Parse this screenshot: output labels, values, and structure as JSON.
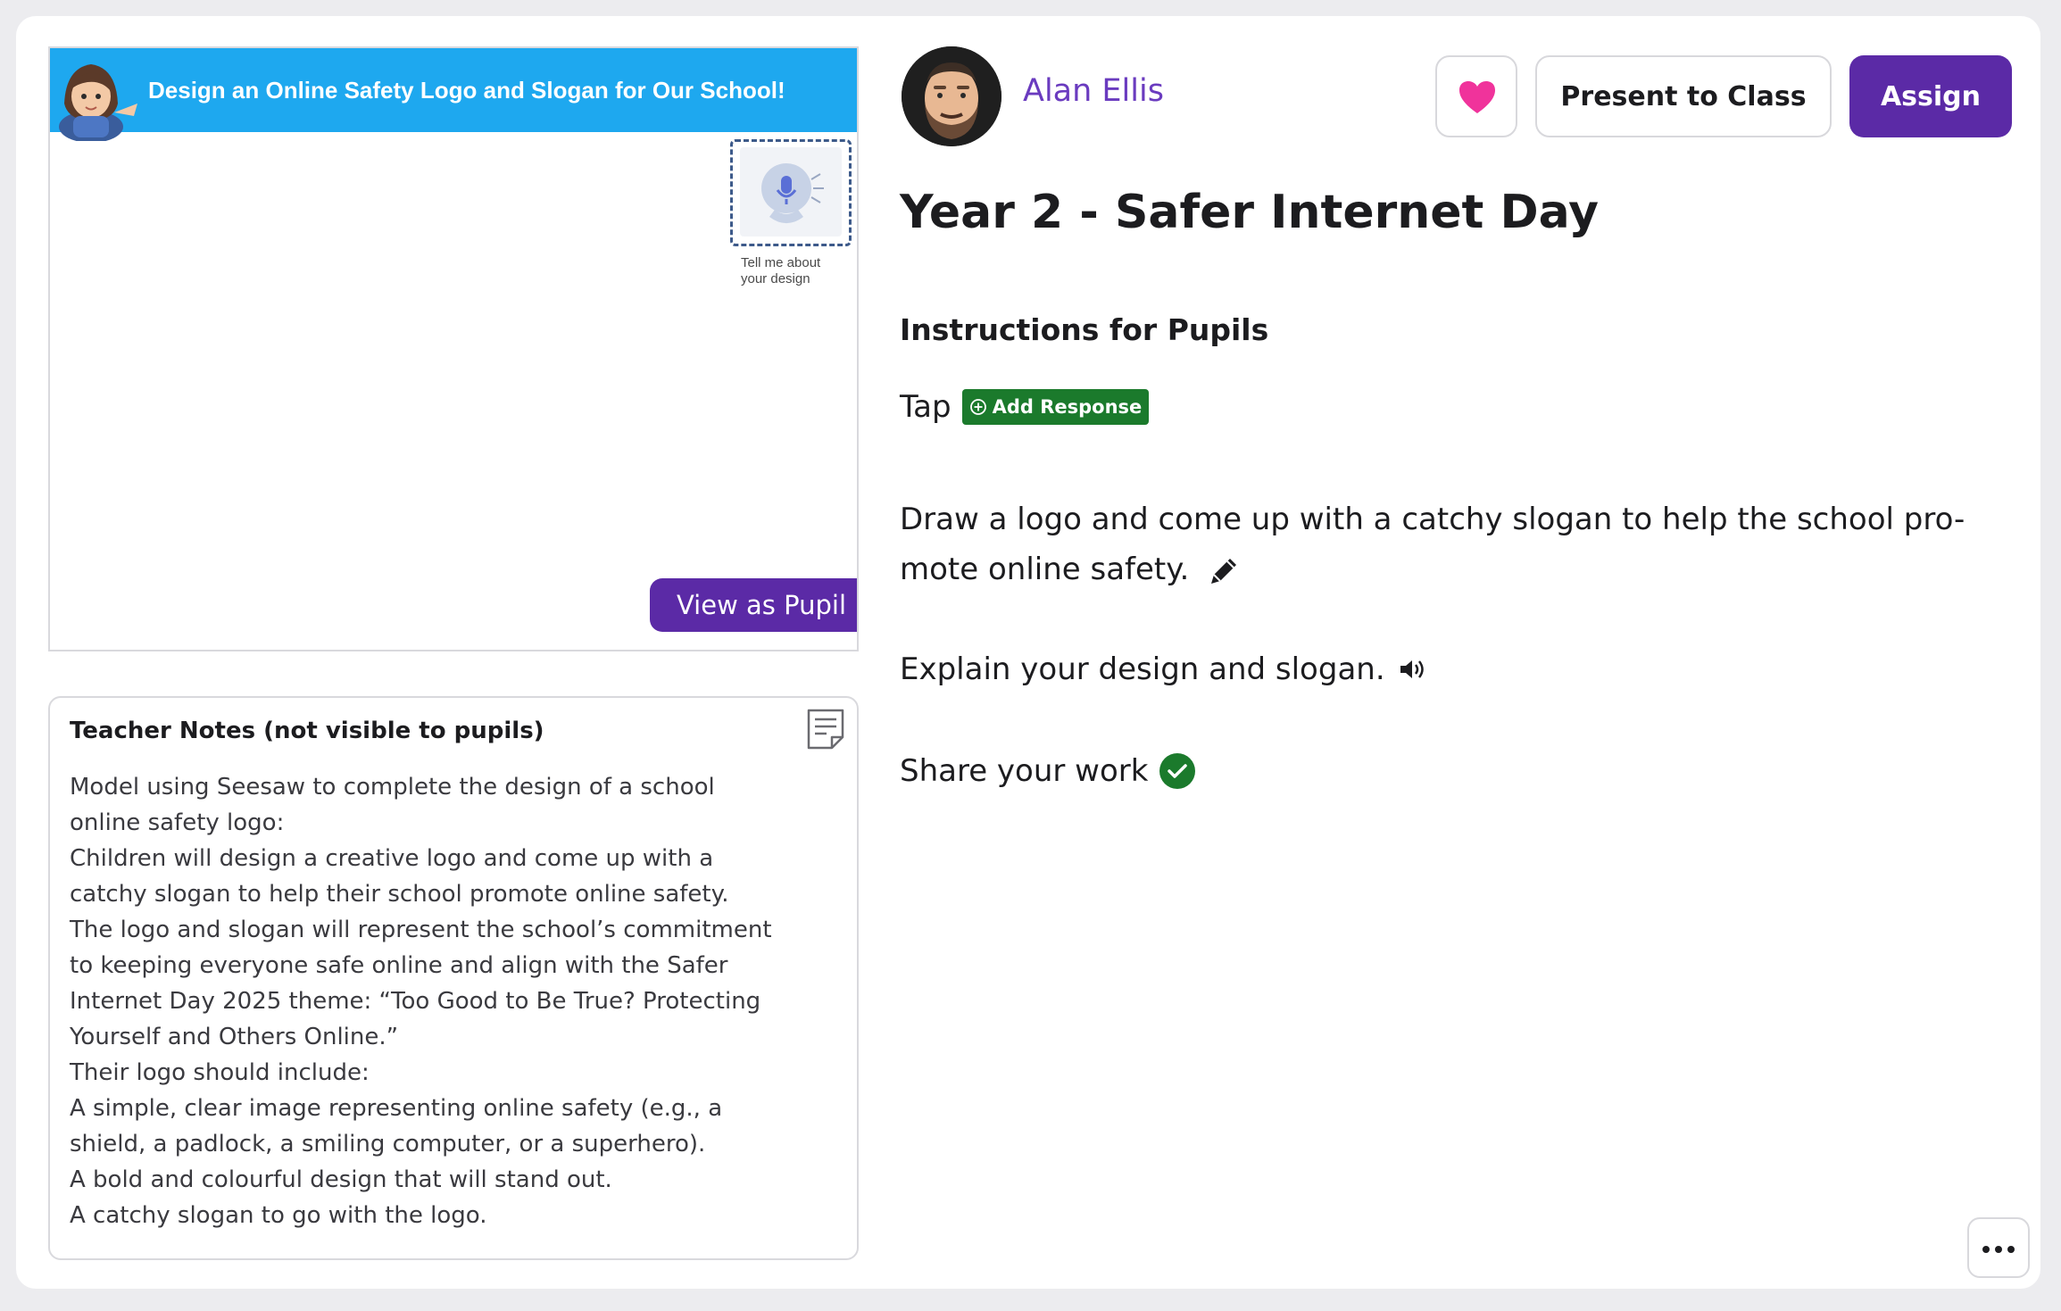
{
  "preview": {
    "banner_title": "Design an Online Safety Logo and Slogan for Our School!",
    "mic_caption_line1": "Tell me about",
    "mic_caption_line2": "your design",
    "view_as_pupil_label": "View as Pupil",
    "banner_color": "#1ea8ef"
  },
  "teacher_notes": {
    "title": "Teacher Notes (not visible to pupils)",
    "lines": [
      "Model using Seesaw to complete the design of a school",
      "online safety logo:",
      "Children will design a creative logo and come up with a",
      "catchy slogan to help their school promote online safety.",
      "The logo and slogan will represent the school’s commitment",
      "to keeping everyone safe online and align with the Safer",
      "Internet Day 2025 theme: “Too Good to Be True? Protecting",
      "Yourself and Others Online.”",
      "Their logo should include:",
      "A simple, clear image representing online safety (e.g., a",
      "shield, a padlock, a smiling computer, or a superhero).",
      "A bold and colourful design that will stand out.",
      "A catchy slogan to go with the logo."
    ],
    "icon": "note-icon"
  },
  "header": {
    "author_name": "Alan Ellis",
    "present_label": "Present to Class",
    "assign_label": "Assign",
    "heart_icon": "heart-icon",
    "heart_color": "#f0339b",
    "accent_color": "#5b2aa6"
  },
  "activity": {
    "title": "Year 2 - Safer Internet Day",
    "instructions_heading": "Instructions for Pupils",
    "tap_word": "Tap",
    "add_response_label": "Add Response",
    "draw_line1": "Draw a logo and come up with a catchy slogan to help the school pro-",
    "draw_line2": "mote online safety.",
    "explain_text": "Explain your design and slogan.",
    "share_text": "Share your work",
    "badge_color": "#1b7a2c",
    "check_color": "#1b7a2c"
  }
}
